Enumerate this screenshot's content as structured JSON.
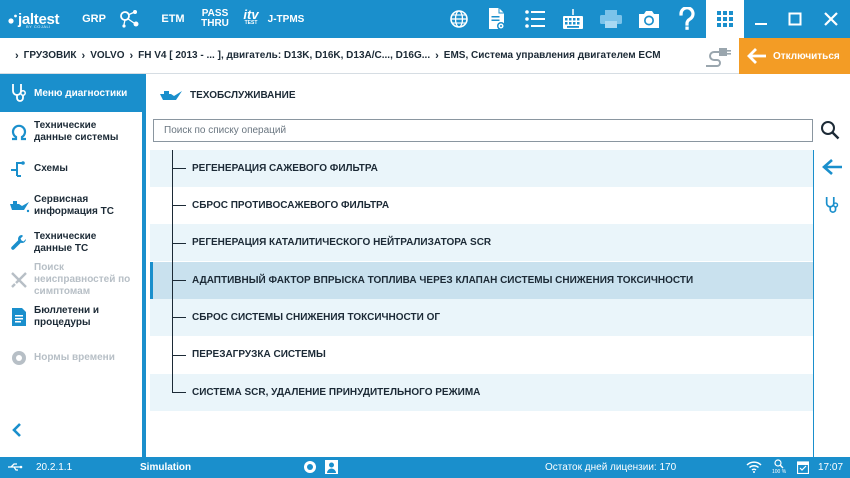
{
  "topbar": {
    "logo_main": "jaltest",
    "logo_sub": "BY COJALI",
    "grp": "GRP",
    "etm": "ETM",
    "pass_line1": "PASS",
    "pass_line2": "THRU",
    "itv_line1": "itv",
    "itv_line2": "TEST",
    "tpms": "J-TPMS"
  },
  "breadcrumb": {
    "items": [
      "ГРУЗОВИК",
      "VOLVO",
      "FH V4 [ 2013 - ... ], двигатель: D13K, D16K, D13A/C..., D16G...",
      "EMS, Система управления двигателем ECM"
    ]
  },
  "disconnect_label": "Отключиться",
  "sidebar": {
    "header": "Меню диагностики",
    "items": [
      {
        "line1": "Технические",
        "line2": "данные системы",
        "line3": ""
      },
      {
        "line1": "Схемы",
        "line2": "",
        "line3": ""
      },
      {
        "line1": "Сервисная",
        "line2": "информация ТС",
        "line3": ""
      },
      {
        "line1": "Технические",
        "line2": "данные ТС",
        "line3": ""
      },
      {
        "line1": "Поиск",
        "line2": "неисправностей по",
        "line3": "симптомам"
      },
      {
        "line1": "Бюллетени и",
        "line2": "процедуры",
        "line3": ""
      },
      {
        "line1": "Нормы времени",
        "line2": "",
        "line3": ""
      }
    ]
  },
  "section_title": "ТЕХОБСЛУЖИВАНИЕ",
  "search": {
    "placeholder": "Поиск по списку операций",
    "value": ""
  },
  "operations": [
    "РЕГЕНЕРАЦИЯ САЖЕВОГО ФИЛЬТРА",
    "СБРОС ПРОТИВОСАЖЕВОГО ФИЛЬТРА",
    "РЕГЕНЕРАЦИЯ КАТАЛИТИЧЕСКОГО НЕЙТРАЛИЗАТОРА SCR",
    "АДАПТИВНЫЙ ФАКТОР ВПРЫСКА ТОПЛИВА ЧЕРЕЗ КЛАПАН СИСТЕМЫ СНИЖЕНИЯ ТОКСИЧНОСТИ",
    "СБРОС СИСТЕМЫ СНИЖЕНИЯ ТОКСИЧНОСТИ ОГ",
    "ПЕРЕЗАГРУЗКА СИСТЕМЫ",
    "СИСТЕМА SCR, УДАЛЕНИЕ ПРИНУДИТЕЛЬНОГО РЕЖИМА"
  ],
  "status": {
    "version": "20.2.1.1",
    "mode": "Simulation",
    "license": "Остаток дней лицензии: 170",
    "zoom": "100 %",
    "time": "17:07"
  },
  "colors": {
    "primary": "#1a8fcc",
    "accent": "#f39c25",
    "selected_row": "#c9e1ee",
    "alt_row": "#eaf5fa"
  }
}
